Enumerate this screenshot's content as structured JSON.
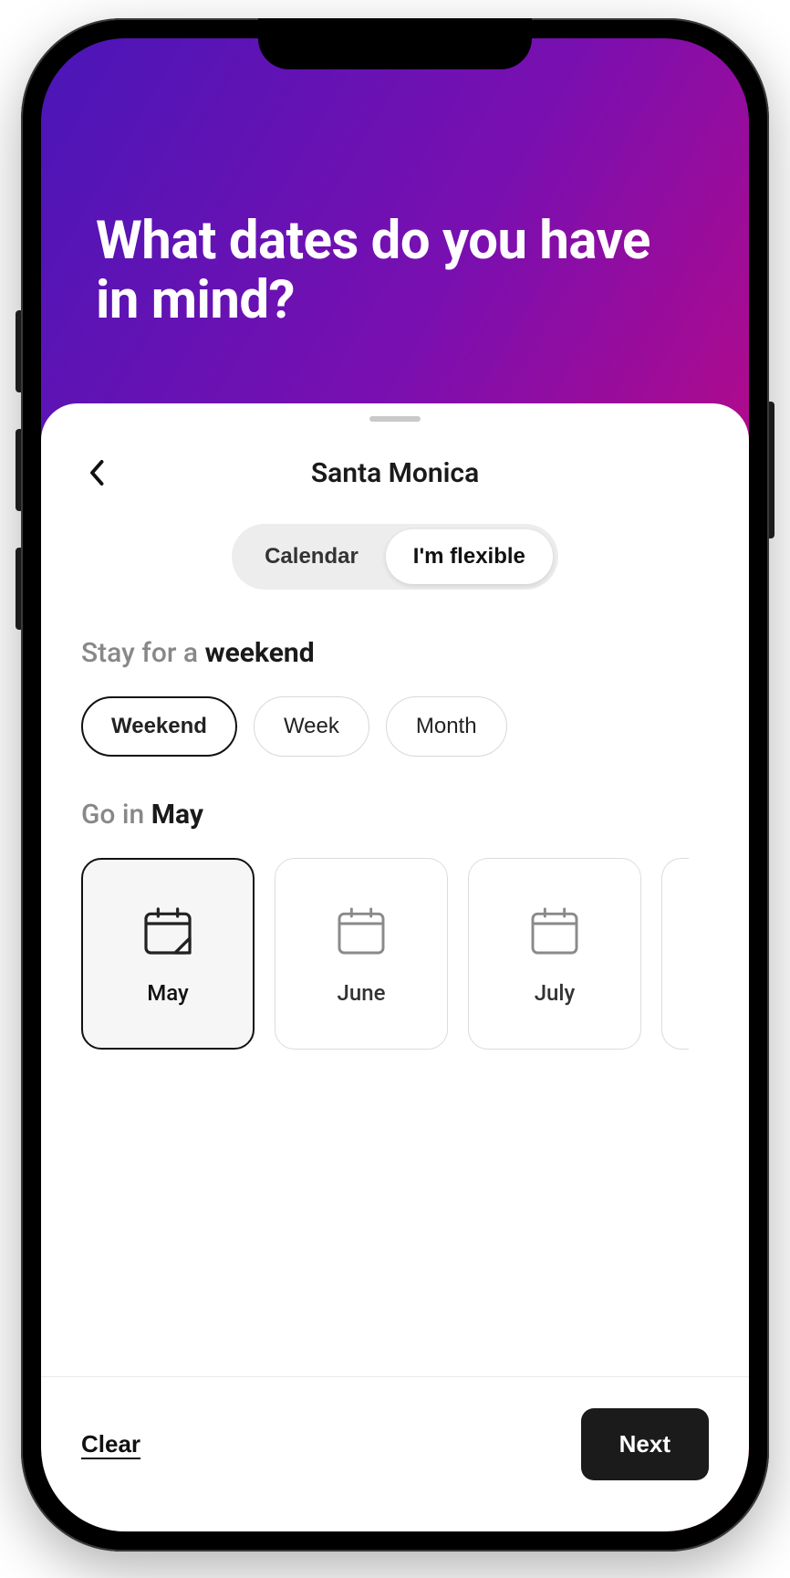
{
  "hero": {
    "title": "What dates do you have in mind?"
  },
  "sheet": {
    "location": "Santa Monica",
    "segmented": {
      "calendar": "Calendar",
      "flexible": "I'm flexible",
      "active": "flexible"
    },
    "stay": {
      "prefix": "Stay for a ",
      "selected_label": "weekend",
      "options": [
        "Weekend",
        "Week",
        "Month"
      ],
      "selected_index": 0
    },
    "go": {
      "prefix": "Go in ",
      "selected_label": "May",
      "months": [
        "May",
        "June",
        "July"
      ],
      "selected_index": 0
    }
  },
  "footer": {
    "clear": "Clear",
    "next": "Next"
  }
}
